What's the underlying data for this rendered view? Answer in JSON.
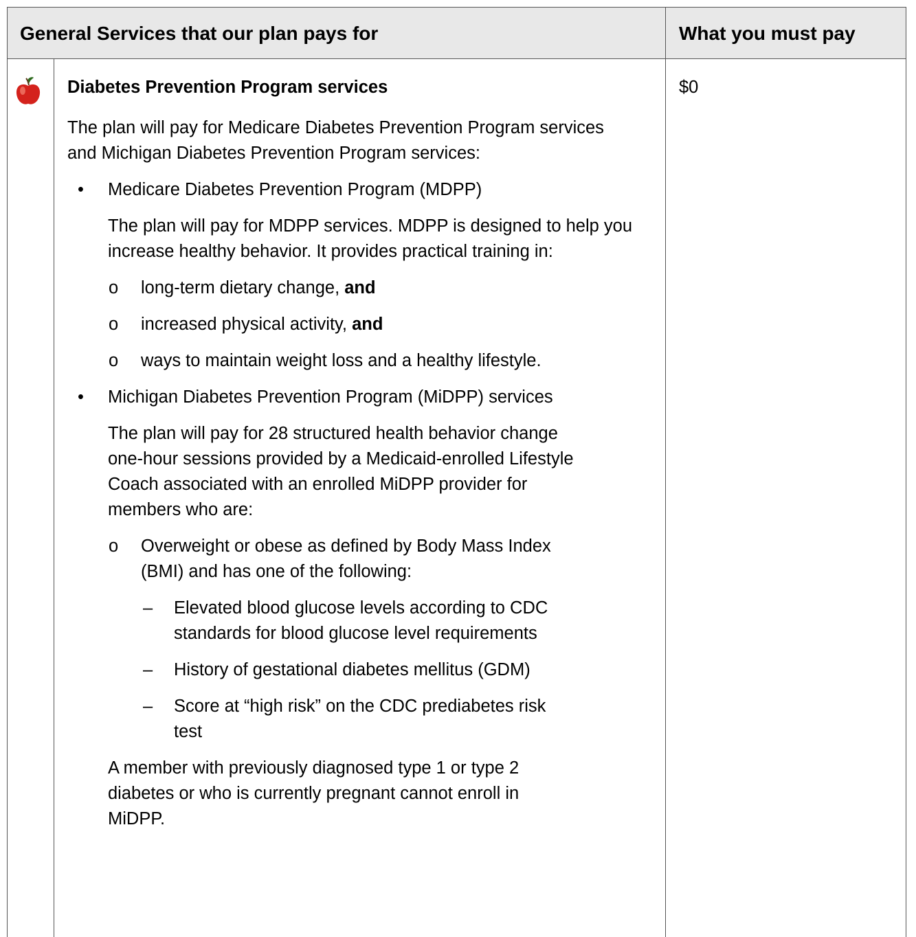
{
  "header": {
    "col1": "General Services that our plan pays for",
    "col2": "What you must pay"
  },
  "row": {
    "icon": "apple-icon",
    "title": "Diabetes Prevention Program services",
    "intro": "The plan will pay for Medicare Diabetes Prevention Program services and Michigan Diabetes Prevention Program services:",
    "bullet1": {
      "label": "Medicare Diabetes Prevention Program (MDPP)",
      "text": "The plan will pay for MDPP services. MDPP is designed to help you increase healthy behavior. It provides practical training in:",
      "items": [
        {
          "text": "long-term dietary change, ",
          "bold": "and"
        },
        {
          "text": "increased physical activity, ",
          "bold": "and"
        },
        {
          "text": "ways to maintain weight loss and a healthy lifestyle.",
          "bold": ""
        }
      ]
    },
    "bullet2": {
      "label": "Michigan Diabetes Prevention Program (MiDPP) services",
      "text": "The plan will pay for 28 structured health behavior change one-hour sessions provided by a Medicaid-enrolled Lifestyle Coach associated with an enrolled MiDPP provider for members who are:",
      "sub": "Overweight or obese as defined by Body Mass Index (BMI) and has one of the following:",
      "dashes": [
        "Elevated blood glucose levels according to CDC standards for blood glucose level requirements",
        "History of gestational diabetes mellitus (GDM)",
        "Score at “high risk” on the CDC prediabetes risk test"
      ],
      "note": "A member with previously diagnosed type 1 or type 2 diabetes or who is currently pregnant cannot enroll in MiDPP."
    },
    "pay": "$0"
  }
}
